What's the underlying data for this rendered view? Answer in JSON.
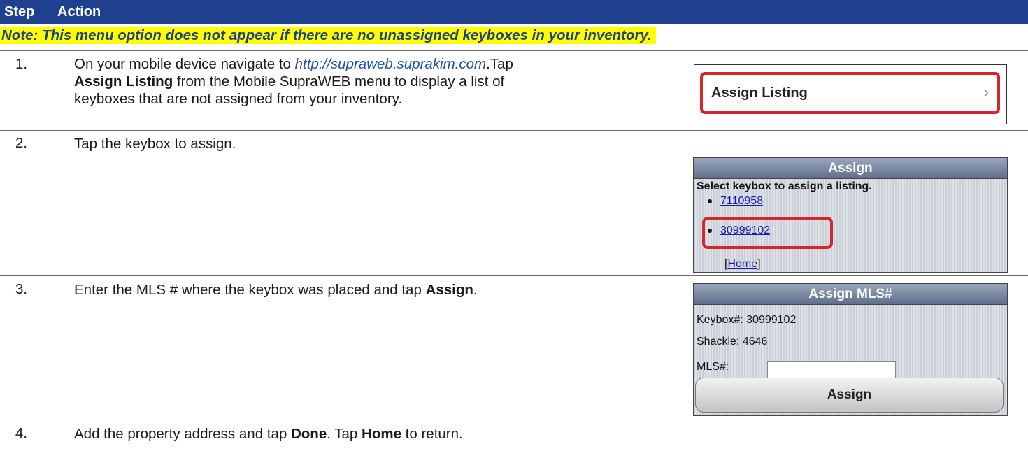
{
  "header": {
    "step": "Step",
    "action": "Action"
  },
  "note": "Note: This menu option does not appear if there are no unassigned keyboxes in your inventory.",
  "steps": [
    {
      "num": "1.",
      "line1_a": "On your mobile device navigate to ",
      "link": "http://supraweb.suprakim.com",
      "line1_b": ".Tap",
      "bold1": "Assign Listing",
      "line2_b": " from the Mobile SupraWEB menu to display a list of",
      "line3": "keyboxes that are not assigned from your inventory."
    },
    {
      "num": "2.",
      "text": "Tap the keybox to assign."
    },
    {
      "num": "3.",
      "text_a": "Enter the MLS # where the keybox was placed and tap ",
      "bold": "Assign",
      "text_b": "."
    },
    {
      "num": "4.",
      "text_a": "Add the property address and tap ",
      "bold1": "Done",
      "text_b": ". Tap ",
      "bold2": "Home",
      "text_c": " to return."
    }
  ],
  "panel1": {
    "label": "Assign Listing",
    "chevron": "›"
  },
  "panel2": {
    "title": "Assign",
    "instruction": "Select keybox to assign a listing.",
    "keyboxes": [
      "7110958",
      "30999102"
    ],
    "home_open": "[",
    "home_link": "Home",
    "home_close": "]"
  },
  "panel3": {
    "title": "Assign MLS#",
    "keybox_label": "Keybox#: 30999102",
    "shackle_label": "Shackle:  4646",
    "mls_label": "MLS#:",
    "mls_value": "",
    "button": "Assign"
  },
  "colors": {
    "header": "#1f3f8f",
    "highlight": "#ffff00",
    "callout": "#d3262f"
  }
}
